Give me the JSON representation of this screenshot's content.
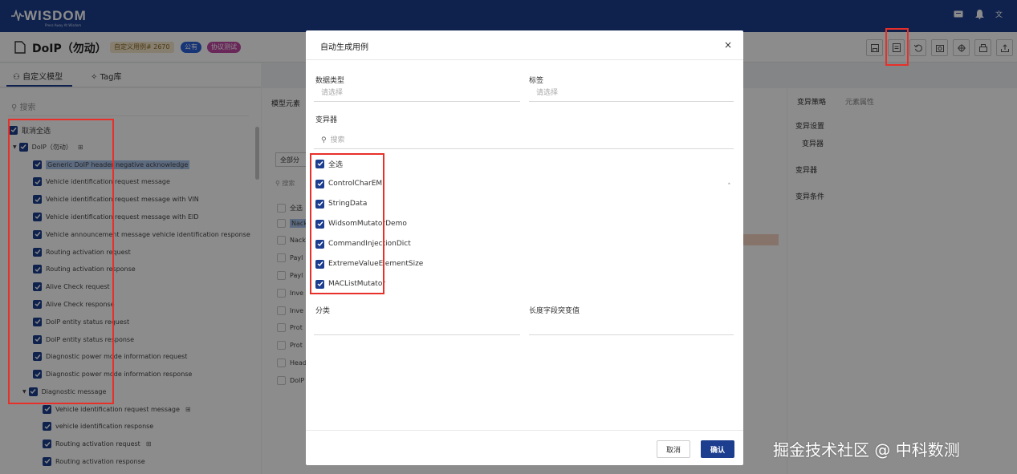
{
  "app": {
    "logo_text": "WISDOM",
    "logo_sub": "Press Away At Wisdom"
  },
  "header": {
    "title": "DoIP（勿动）",
    "badges": [
      "自定义用例# 2670",
      "公有",
      "协议测试"
    ]
  },
  "left_tabs": [
    "自定义模型",
    "Tag库"
  ],
  "left_search_placeholder": "搜索",
  "tree": {
    "select_all": "取消全选",
    "root": "DoIP（勿动）",
    "items": [
      "Generic DoIP header negative acknowledge",
      "Vehicle identification request message",
      "Vehicle identification request message with VIN",
      "Vehicle identification request message with EID",
      "Vehicle announcement message vehicle identification response",
      "Routing activation request",
      "Routing activation response",
      "Alive Check request",
      "Alive Check response",
      "DoIP entity status request",
      "DoIP entity status response",
      "Diagnostic power mode information request",
      "Diagnostic power mode information response",
      "Diagnostic message"
    ],
    "sub_items": [
      "Vehicle identification request message",
      "vehicle identification response",
      "Routing activation request",
      "Routing activation response"
    ]
  },
  "middle": {
    "header": "模型元素",
    "filter": "全部分",
    "search": "搜索",
    "select_all": "全选",
    "rows": [
      "Nack",
      "Nack",
      "Payl",
      "Payl",
      "Inve",
      "Inve",
      "Prot",
      "Prot",
      "Head",
      "DoIP"
    ]
  },
  "right": {
    "tabs": [
      "变异策略",
      "元素属性"
    ],
    "setting_label": "变异设置",
    "setting_value": "变异器",
    "mutator_label": "变异器",
    "condition_label": "变异条件"
  },
  "modal": {
    "title": "自动生成用例",
    "close": "×",
    "data_type_label": "数据类型",
    "data_type_placeholder": "请选择",
    "tag_label": "标签",
    "tag_placeholder": "请选择",
    "mutator_label": "变异器",
    "search_placeholder": "搜索",
    "mutators": [
      "全选",
      "ControlCharEM",
      "StringData",
      "WidsomMutatorDemo",
      "CommandInjectionDict",
      "ExtremeValueElementSize",
      "MACListMutator"
    ],
    "category_label": "分类",
    "length_label": "长度字段突变值",
    "cancel": "取消",
    "confirm": "确认"
  },
  "watermark": "掘金技术社区 @ 中科数测",
  "colors": {
    "primary": "#1d3e8e",
    "highlight": "#e8302a"
  }
}
